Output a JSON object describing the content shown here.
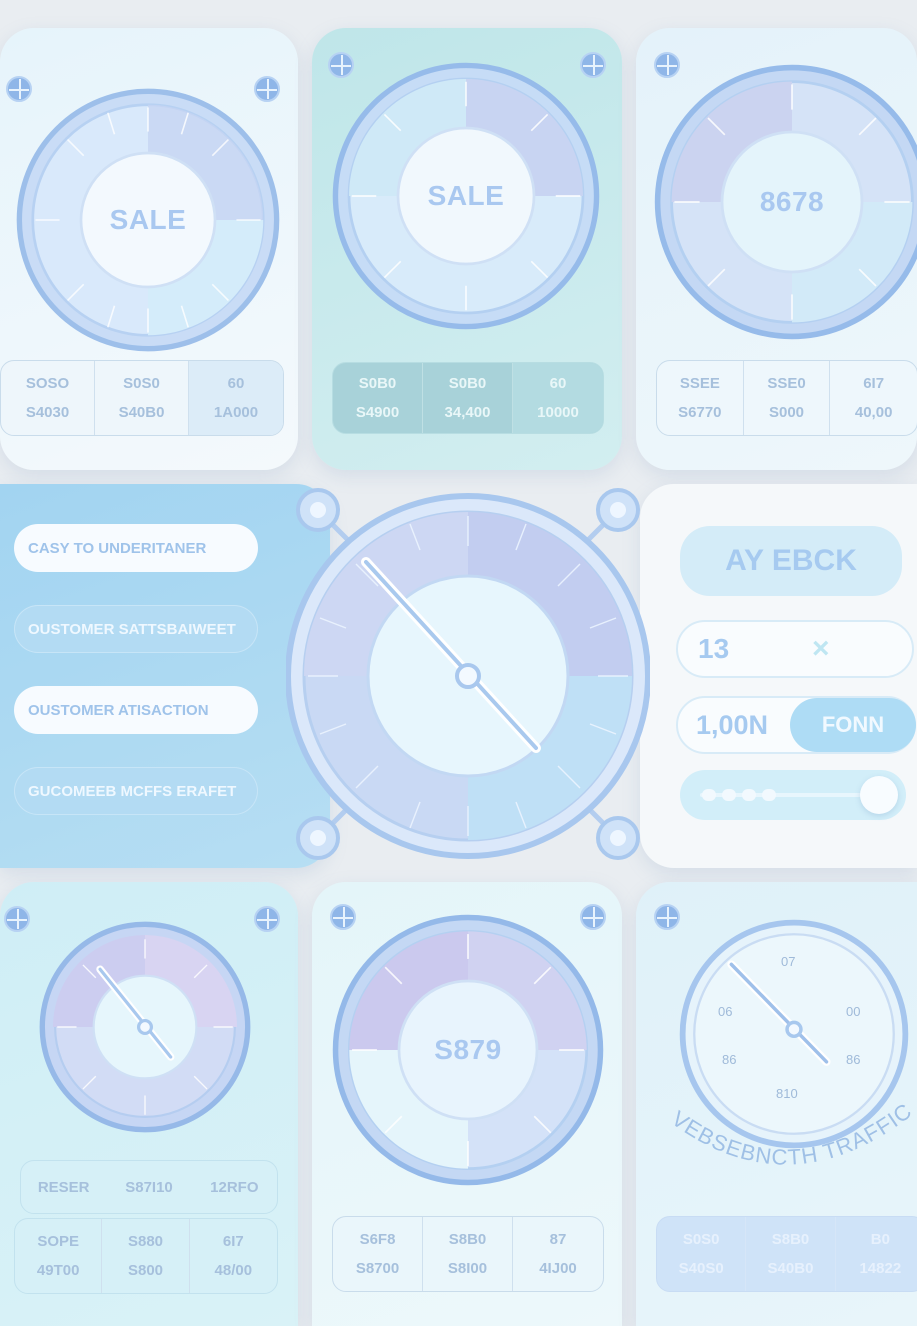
{
  "top_cards": [
    {
      "center": "SALE",
      "rows": [
        [
          "SOSO",
          "S4030"
        ],
        [
          "S0S0",
          "S40B0"
        ],
        [
          "60",
          "1A000"
        ]
      ]
    },
    {
      "center": "SALE",
      "rows": [
        [
          "S0B0",
          "S4900"
        ],
        [
          "S0B0",
          "34,400"
        ],
        [
          "60",
          "10000"
        ]
      ]
    },
    {
      "center": "8678",
      "rows": [
        [
          "SSEE",
          "S6770"
        ],
        [
          "SSE0",
          "S000"
        ],
        [
          "6I7",
          "40,00"
        ]
      ]
    }
  ],
  "left_panel": {
    "buttons": [
      "CASY TO UNDERITANER",
      "OUSTOMER SATTSBAIWEET",
      "OUSTOMER ATISACTION",
      "GUCOMEEB MCFFS ERAFET"
    ]
  },
  "right_panel": {
    "primary_button": "AY EBCK",
    "input_value": "13",
    "clear_icon": "×",
    "amount_value": "1,00N",
    "amount_button": "FONN",
    "slider_value": 0.88
  },
  "bottom_cards": [
    {
      "rows": [
        [
          "RESER",
          "SOPE",
          "49T00"
        ],
        [
          "S87I10",
          "S880",
          "S800"
        ],
        [
          "12RFO",
          "6I7",
          "48/00"
        ]
      ]
    },
    {
      "center": "S879",
      "rows": [
        [
          "S6F8",
          "S8700"
        ],
        [
          "S8B0",
          "S8I00"
        ],
        [
          "87",
          "4IJ00"
        ]
      ]
    },
    {
      "dial_labels": [
        "07",
        "06",
        "00",
        "86",
        "86",
        "810"
      ],
      "arc_text": "VEBSEBNCTH TRAFFIC",
      "rows": [
        [
          "S0S0",
          "S40S0"
        ],
        [
          "S8B0",
          "S40B0"
        ],
        [
          "B0",
          "14822"
        ]
      ]
    }
  ],
  "colors": {
    "accent": "#9fc2ee",
    "panel_blue": "#a9d8f2",
    "teal": "#c2eaea"
  }
}
